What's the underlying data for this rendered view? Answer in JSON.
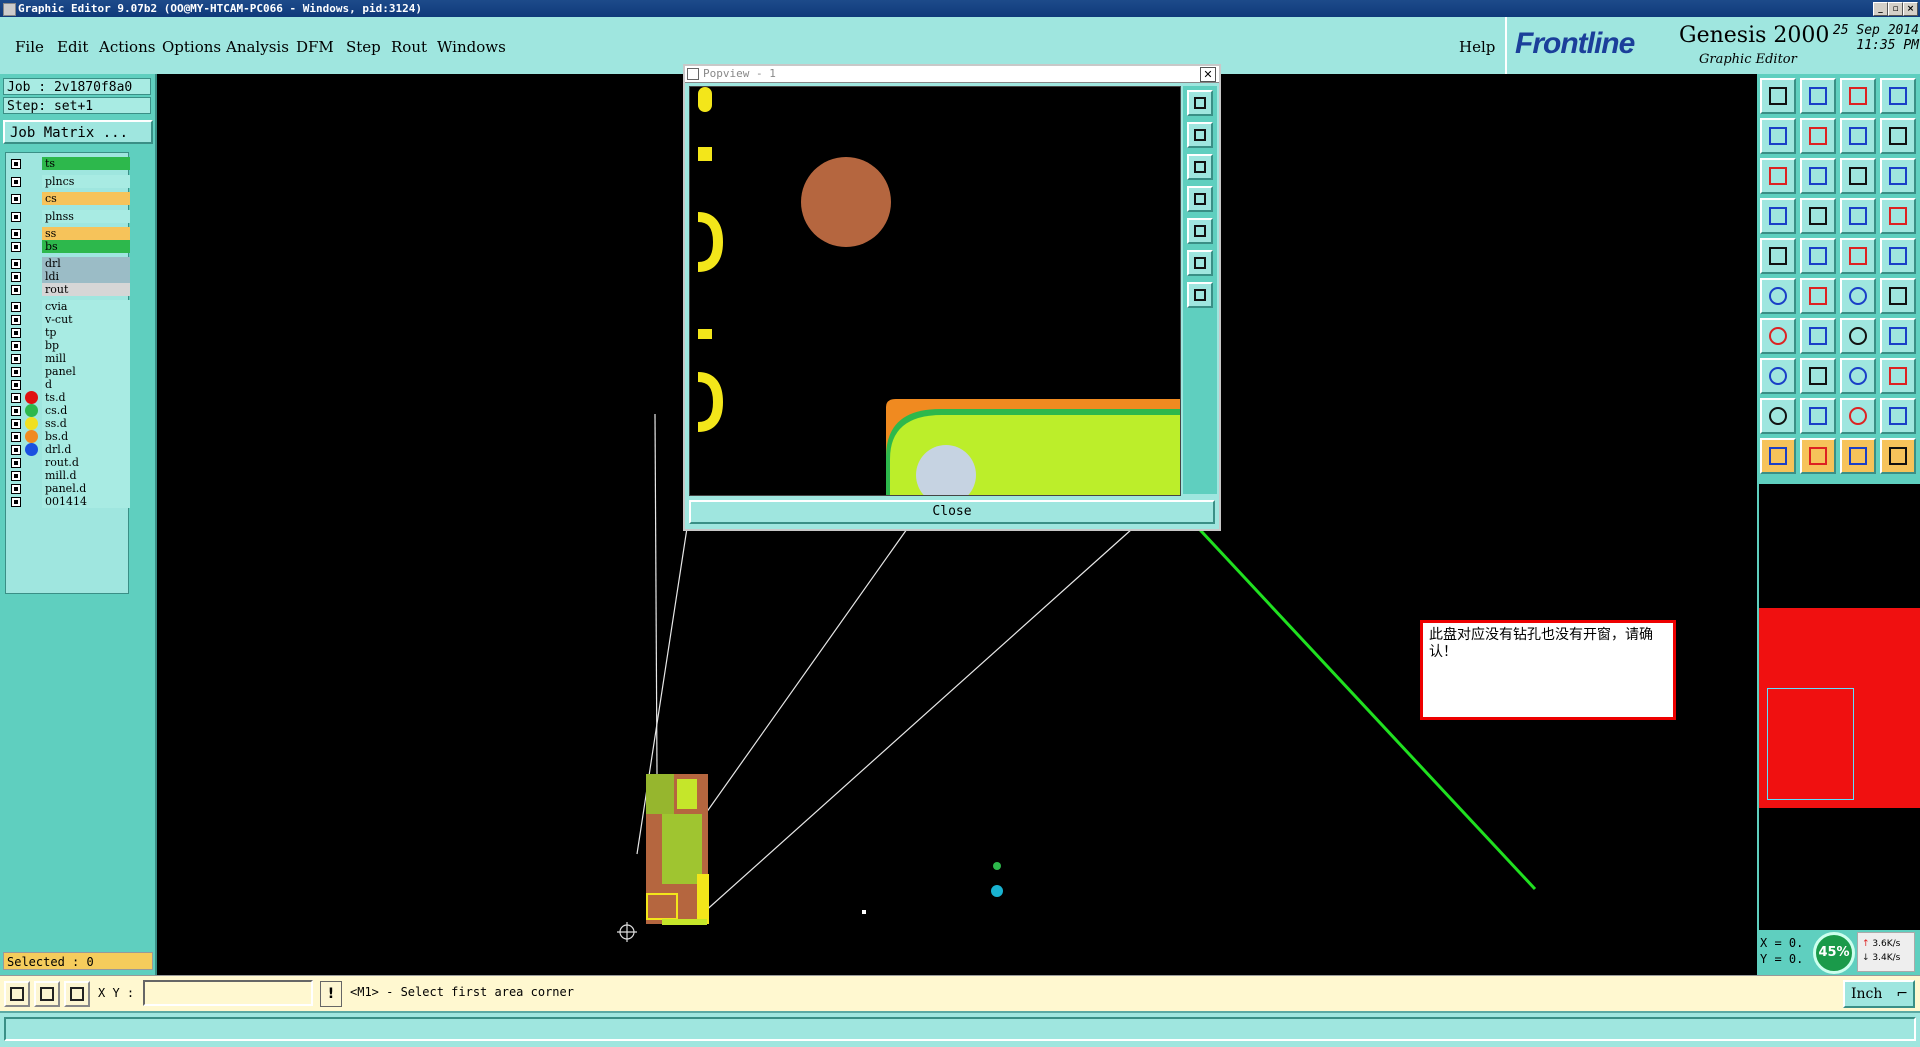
{
  "window": {
    "title": "Graphic Editor 9.07b2 (OO@MY-HTCAM-PC066 - Windows, pid:3124)"
  },
  "menu": {
    "items": [
      {
        "label": "File"
      },
      {
        "label": "Edit"
      },
      {
        "label": "Actions"
      },
      {
        "label": "Options"
      },
      {
        "label": "Analysis"
      },
      {
        "label": "DFM"
      },
      {
        "label": "Step"
      },
      {
        "label": "Rout"
      },
      {
        "label": "Windows"
      }
    ],
    "help": "Help"
  },
  "brand": {
    "logo": "Frontline",
    "product": "Genesis 2000",
    "subtitle": "Graphic Editor",
    "date": "25 Sep 2014",
    "time": "11:35 PM"
  },
  "job": {
    "job_label": "Job : 2v1870f8a0",
    "step_label": "Step: set+1",
    "job_matrix_button": "Job Matrix ...",
    "selected": "Selected : 0"
  },
  "layers": [
    {
      "name": "ts",
      "color": "#2db84c",
      "dot": ""
    },
    {
      "name": "plncs",
      "color": "#a8ebe3",
      "dot": ""
    },
    {
      "name": "cs",
      "color": "#f6c35a",
      "dot": ""
    },
    {
      "name": "plnss",
      "color": "#a8ebe3",
      "dot": ""
    },
    {
      "name": "ss",
      "color": "#f6c35a",
      "dot": ""
    },
    {
      "name": "bs",
      "color": "#2db84c",
      "dot": ""
    },
    {
      "name": "drl",
      "color": "#9bbcc6",
      "dot": ""
    },
    {
      "name": "ldi",
      "color": "#9bbcc6",
      "dot": ""
    },
    {
      "name": "rout",
      "color": "#d6d6d6",
      "dot": ""
    },
    {
      "name": "cvia",
      "color": "#a8ebe3",
      "dot": ""
    },
    {
      "name": "v-cut",
      "color": "#a8ebe3",
      "dot": ""
    },
    {
      "name": "tp",
      "color": "#a8ebe3",
      "dot": ""
    },
    {
      "name": "bp",
      "color": "#a8ebe3",
      "dot": ""
    },
    {
      "name": "mill",
      "color": "#a8ebe3",
      "dot": ""
    },
    {
      "name": "panel",
      "color": "#a8ebe3",
      "dot": ""
    },
    {
      "name": "d",
      "color": "#a8ebe3",
      "dot": ""
    },
    {
      "name": "ts.d",
      "color": "#a8ebe3",
      "dot": "#e01010"
    },
    {
      "name": "cs.d",
      "color": "#a8ebe3",
      "dot": "#2db84c"
    },
    {
      "name": "ss.d",
      "color": "#a8ebe3",
      "dot": "#f0e020"
    },
    {
      "name": "bs.d",
      "color": "#a8ebe3",
      "dot": "#f08a20"
    },
    {
      "name": "drl.d",
      "color": "#a8ebe3",
      "dot": "#1a50e0"
    },
    {
      "name": "rout.d",
      "color": "#a8ebe3",
      "dot": ""
    },
    {
      "name": "mill.d",
      "color": "#a8ebe3",
      "dot": ""
    },
    {
      "name": "panel.d",
      "color": "#a8ebe3",
      "dot": ""
    },
    {
      "name": "001414",
      "color": "#a8ebe3",
      "dot": ""
    }
  ],
  "popup": {
    "title": "Popview - 1",
    "close_button": "Close"
  },
  "message": {
    "text": "此盘对应没有钻孔也没有开窗，请确认！"
  },
  "coords": {
    "x": "X = 0.",
    "y": "Y = 0.",
    "cpu": "45%",
    "net_up": "3.6K/s",
    "net_down": "3.4K/s"
  },
  "status": {
    "xy_label": "X Y :",
    "xy_value": "",
    "prompt_icon": "!",
    "prompt": "<M1> - Select first area corner",
    "units": "Inch"
  },
  "colors": {
    "panel": "#9fe6df",
    "accent_dark": "#5fcfbf",
    "highlight_red": "#f01010",
    "arrow_green": "#20e020"
  }
}
